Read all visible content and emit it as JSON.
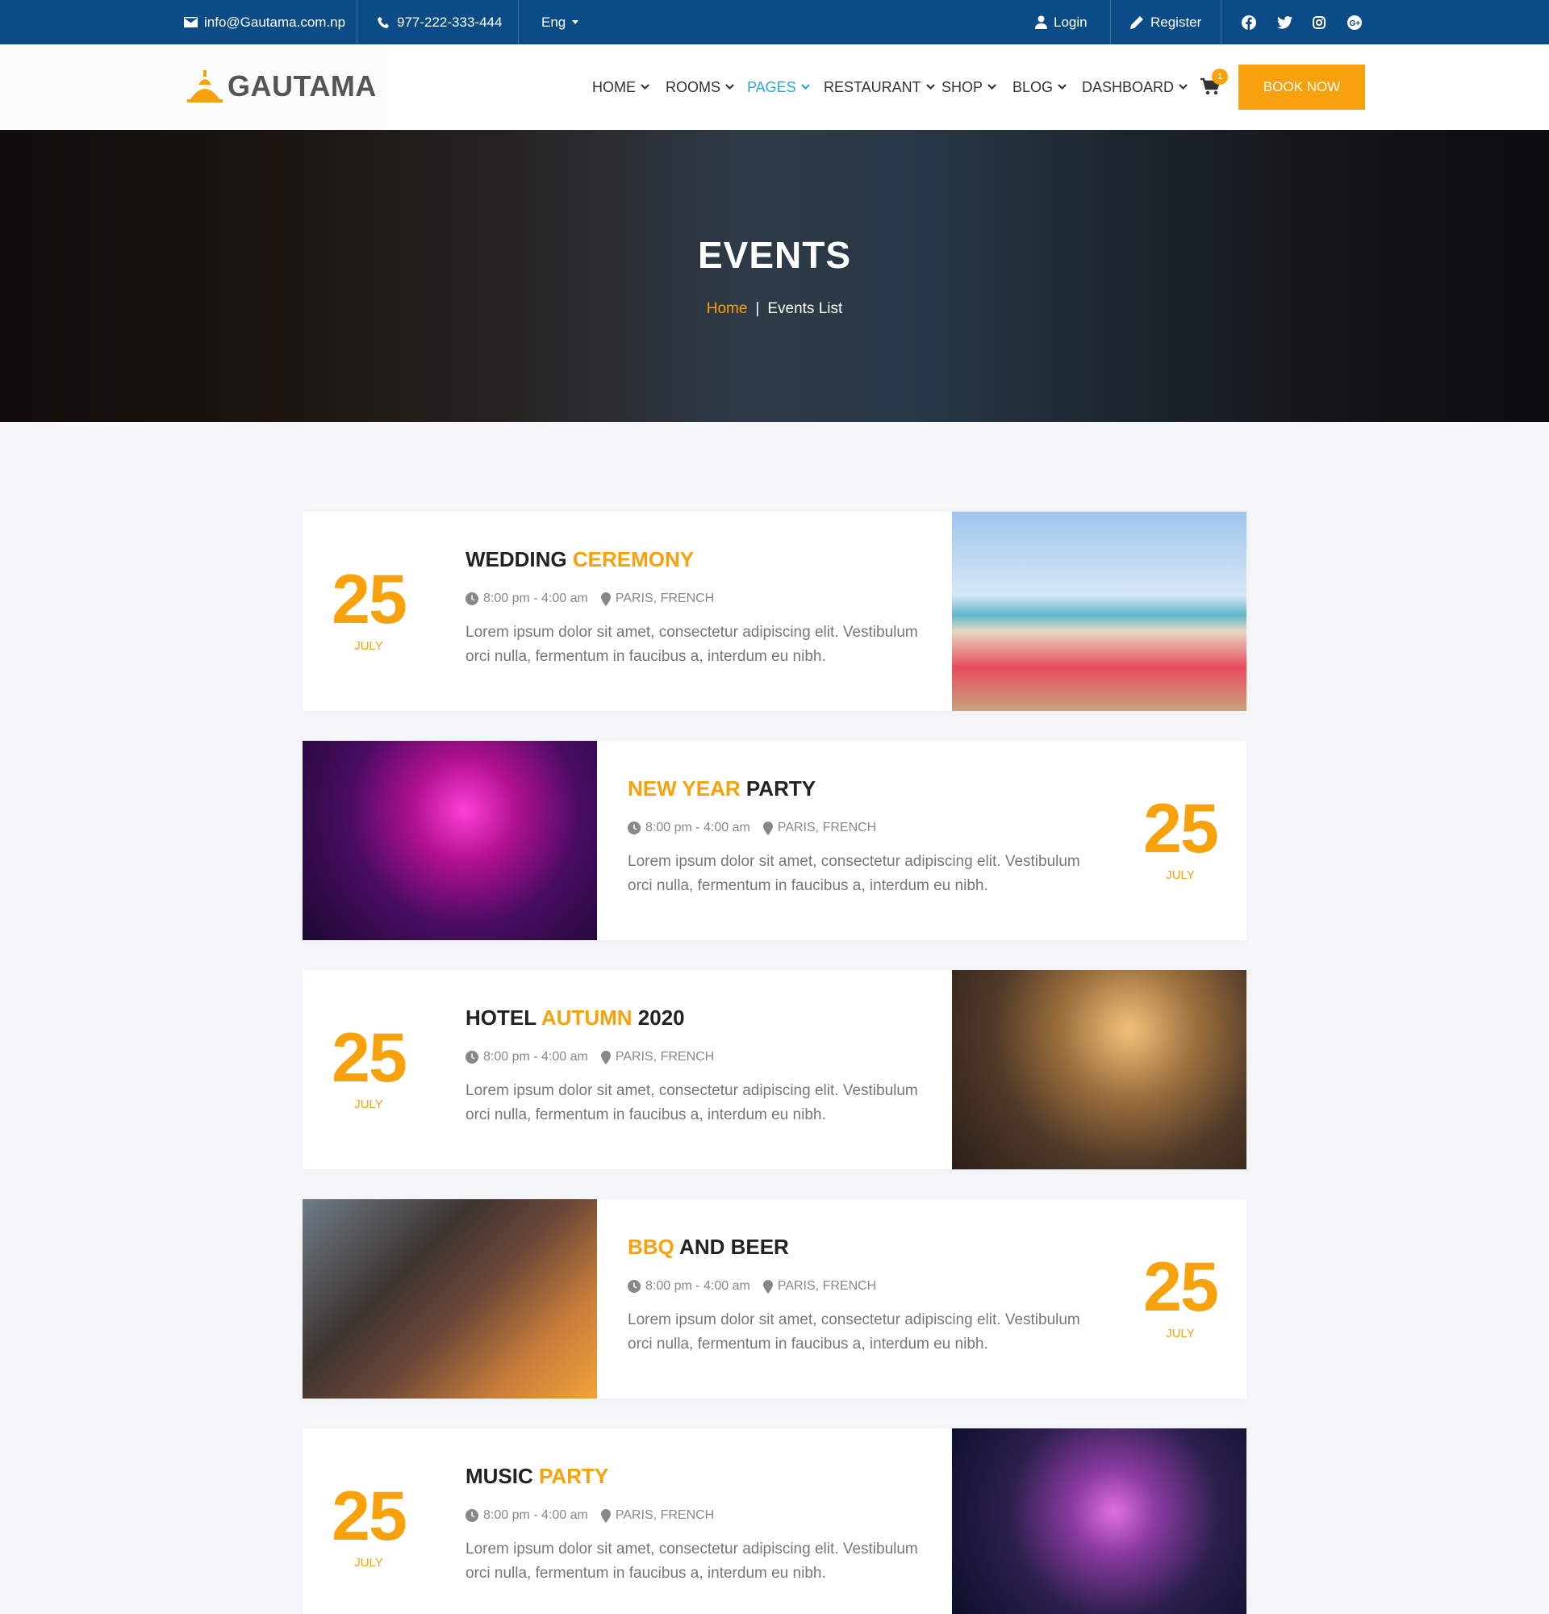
{
  "topbar": {
    "email": "info@Gautama.com.np",
    "phone": "977-222-333-444",
    "language": "Eng",
    "login": "Login",
    "register": "Register",
    "social_icons": [
      "facebook-icon",
      "twitter-icon",
      "instagram-icon",
      "google-plus-icon"
    ]
  },
  "brand": {
    "name": "GAUTAMA"
  },
  "nav": {
    "items": [
      {
        "label": "HOME"
      },
      {
        "label": "ROOMS"
      },
      {
        "label": "PAGES",
        "active": true
      },
      {
        "label": "RESTAURANT"
      },
      {
        "label": "SHOP"
      },
      {
        "label": "BLOG"
      },
      {
        "label": "DASHBOARD"
      }
    ],
    "cart_count": "1",
    "book_now": "BOOK NOW"
  },
  "hero": {
    "title": "EVENTS",
    "breadcrumb_home": "Home",
    "breadcrumb_sep": "|",
    "breadcrumb_current": "Events List"
  },
  "events": [
    {
      "title_a": "WEDDING ",
      "title_b": "CEREMONY",
      "title_c": "",
      "day": "25",
      "month": "JULY",
      "time": "8:00 pm - 4:00 am",
      "location": "PARIS, FRENCH",
      "desc": "Lorem ipsum dolor sit amet, consectetur adipiscing elit. Vestibulum orci nulla, fermentum in faucibus a, interdum eu nibh."
    },
    {
      "title_a": "",
      "title_b": "NEW YEAR",
      "title_c": " PARTY",
      "day": "25",
      "month": "JULY",
      "time": "8:00 pm - 4:00 am",
      "location": "PARIS, FRENCH",
      "desc": "Lorem ipsum dolor sit amet, consectetur adipiscing elit. Vestibulum orci nulla, fermentum in faucibus a, interdum eu nibh."
    },
    {
      "title_a": "HOTEL ",
      "title_b": "AUTUMN",
      "title_c": " 2020",
      "day": "25",
      "month": "JULY",
      "time": "8:00 pm - 4:00 am",
      "location": "PARIS, FRENCH",
      "desc": "Lorem ipsum dolor sit amet, consectetur adipiscing elit. Vestibulum orci nulla, fermentum in faucibus a, interdum eu nibh."
    },
    {
      "title_a": "",
      "title_b": "BBQ",
      "title_c": " AND BEER",
      "day": "25",
      "month": "JULY",
      "time": "8:00 pm - 4:00 am",
      "location": "PARIS, FRENCH",
      "desc": "Lorem ipsum dolor sit amet, consectetur adipiscing elit. Vestibulum orci nulla, fermentum in faucibus a, interdum eu nibh."
    },
    {
      "title_a": "MUSIC ",
      "title_b": "PARTY",
      "title_c": "",
      "day": "25",
      "month": "JULY",
      "time": "8:00 pm - 4:00 am",
      "location": "PARIS, FRENCH",
      "desc": "Lorem ipsum dolor sit amet, consectetur adipiscing elit. Vestibulum orci nulla, fermentum in faucibus a, interdum eu nibh."
    }
  ],
  "colors": {
    "topbar": "#0b4b86",
    "accent": "#f7a10d",
    "nav_active": "#31a6d9"
  }
}
